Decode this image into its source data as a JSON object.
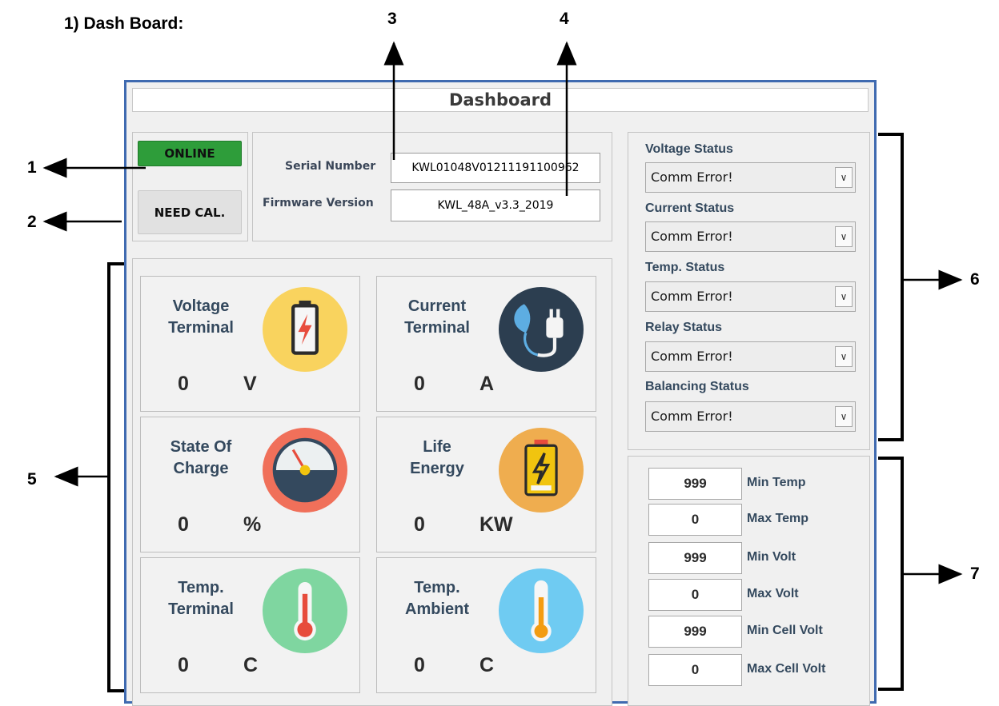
{
  "doc": {
    "heading": "1)   Dash Board:",
    "callouts": [
      "1",
      "2",
      "3",
      "4",
      "5",
      "6",
      "7"
    ]
  },
  "window": {
    "title": "Dashboard"
  },
  "connection": {
    "online_label": "ONLINE",
    "calibration_label": "NEED CAL."
  },
  "device_info": {
    "serial_label": "Serial Number",
    "serial_value": "KWL01048V01211191100962",
    "firmware_label": "Firmware Version",
    "firmware_value": "KWL_48A_v3.3_2019"
  },
  "tiles": [
    {
      "title_line1": "Voltage",
      "title_line2": "Terminal",
      "value": "0",
      "unit": "V",
      "icon": "battery-bolt-icon",
      "icon_color": "#f9d35e"
    },
    {
      "title_line1": "Current",
      "title_line2": "Terminal",
      "value": "0",
      "unit": "A",
      "icon": "eco-plug-icon",
      "icon_color": "#2c3e50"
    },
    {
      "title_line1": "State Of",
      "title_line2": "Charge",
      "value": "0",
      "unit": "%",
      "icon": "gauge-icon",
      "icon_color": "#f0705a"
    },
    {
      "title_line1": "Life",
      "title_line2": "Energy",
      "value": "0",
      "unit": "KW",
      "icon": "energy-battery-icon",
      "icon_color": "#efad4f"
    },
    {
      "title_line1": "Temp.",
      "title_line2": "Terminal",
      "value": "0",
      "unit": "C",
      "icon": "thermometer-red-icon",
      "icon_color": "#7fd6a0"
    },
    {
      "title_line1": "Temp.",
      "title_line2": "Ambient",
      "value": "0",
      "unit": "C",
      "icon": "thermometer-yellow-icon",
      "icon_color": "#6fcbf2"
    }
  ],
  "statuses": [
    {
      "label": "Voltage  Status",
      "value": "Comm Error!"
    },
    {
      "label": "Current Status",
      "value": "Comm Error!"
    },
    {
      "label": "Temp. Status",
      "value": "Comm Error!"
    },
    {
      "label": "Relay Status",
      "value": "Comm Error!"
    },
    {
      "label": "Balancing Status",
      "value": "Comm Error!"
    }
  ],
  "minmax": [
    {
      "value": "999",
      "label": "Min Temp"
    },
    {
      "value": "0",
      "label": "Max Temp"
    },
    {
      "value": "999",
      "label": "Min Volt"
    },
    {
      "value": "0",
      "label": "Max Volt"
    },
    {
      "value": "999",
      "label": "Min Cell Volt"
    },
    {
      "value": "0",
      "label": "Max Cell Volt"
    }
  ],
  "colors": {
    "window_border": "#3f6ab0",
    "online_green": "#2e9d3a",
    "label_navy": "#34495e"
  }
}
